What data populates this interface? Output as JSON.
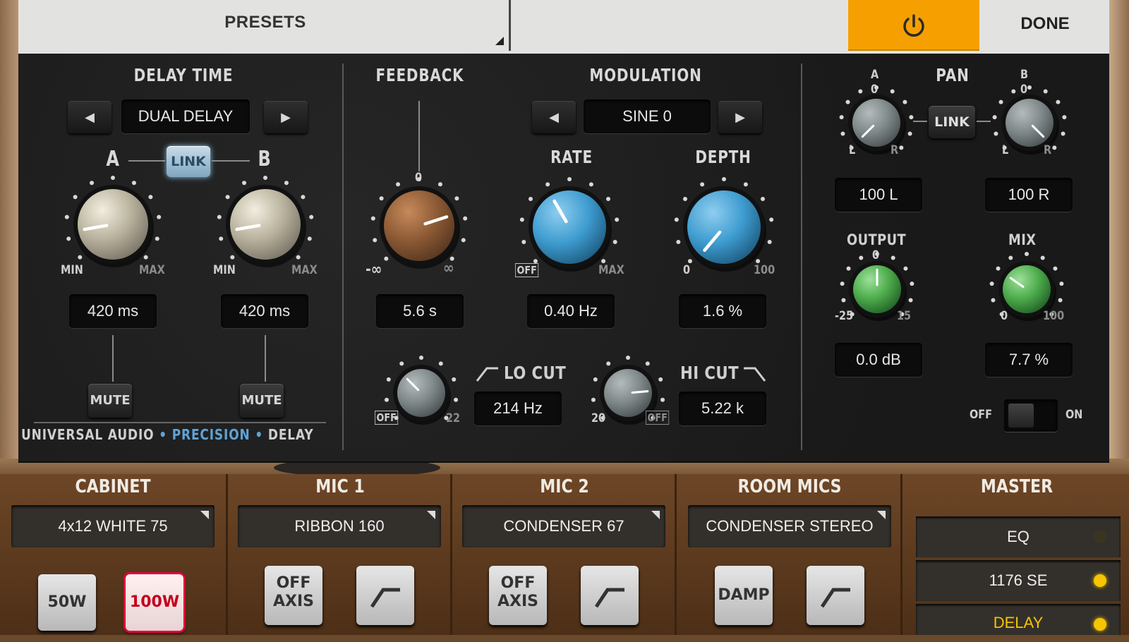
{
  "header": {
    "presets_label": "PRESETS",
    "done_label": "DONE",
    "power_color": "#f5a000"
  },
  "delay_time": {
    "title": "DELAY TIME",
    "mode": "DUAL DELAY",
    "channel_a": "A",
    "channel_b": "B",
    "link_label": "LINK",
    "link_active": true,
    "knob_min": "MIN",
    "knob_max": "MAX",
    "a_value": "420 ms",
    "b_value": "420 ms",
    "mute_label": "MUTE"
  },
  "feedback": {
    "title": "FEEDBACK",
    "zero_mark": "0",
    "min_label": "-∞",
    "max_label": "∞",
    "value": "5.6 s"
  },
  "modulation": {
    "title": "MODULATION",
    "waveform": "SINE 0",
    "rate_title": "RATE",
    "rate_off": "OFF",
    "rate_max": "MAX",
    "rate_value": "0.40 Hz",
    "depth_title": "DEPTH",
    "depth_min": "0",
    "depth_max": "100",
    "depth_value": "1.6 %"
  },
  "filters": {
    "lo_cut_title": "LO CUT",
    "lo_cut_off": "OFF",
    "lo_cut_max": "22",
    "lo_cut_value": "214 Hz",
    "hi_cut_title": "HI CUT",
    "hi_cut_min": "20",
    "hi_cut_off": "OFF",
    "hi_cut_value": "5.22 k"
  },
  "pan": {
    "title": "PAN",
    "a_label": "A",
    "b_label": "B",
    "zero_mark": "0",
    "l_label": "L",
    "r_label": "R",
    "link_label": "LINK",
    "a_value": "100 L",
    "b_value": "100 R"
  },
  "output": {
    "title": "OUTPUT",
    "zero_mark": "0",
    "min_label": "-25",
    "max_label": "15",
    "value": "0.0 dB"
  },
  "mix": {
    "title": "MIX",
    "min_label": "0",
    "max_label": "100",
    "value": "7.7 %",
    "switch_off": "OFF",
    "switch_on": "ON"
  },
  "brand": {
    "part1": "UNIVERSAL AUDIO",
    "sep": "•",
    "part2": "PRECISION",
    "part3": "DELAY"
  },
  "bottom": {
    "cabinet": {
      "title": "CABINET",
      "selection": "4x12 WHITE 75",
      "btn1": "50W",
      "btn2": "100W",
      "active": "100W"
    },
    "mic1": {
      "title": "MIC 1",
      "selection": "RIBBON 160",
      "btn1": "OFF AXIS"
    },
    "mic2": {
      "title": "MIC 2",
      "selection": "CONDENSER 67",
      "btn1": "OFF AXIS"
    },
    "room": {
      "title": "ROOM MICS",
      "selection": "CONDENSER STEREO",
      "btn1": "DAMP"
    },
    "master": {
      "title": "MASTER",
      "items": [
        {
          "label": "EQ",
          "led": "off"
        },
        {
          "label": "1176 SE",
          "led": "on"
        },
        {
          "label": "DELAY",
          "led": "on",
          "highlight": true
        }
      ],
      "led_on_color": "#f7c400",
      "highlight_color": "#f7c400"
    }
  }
}
